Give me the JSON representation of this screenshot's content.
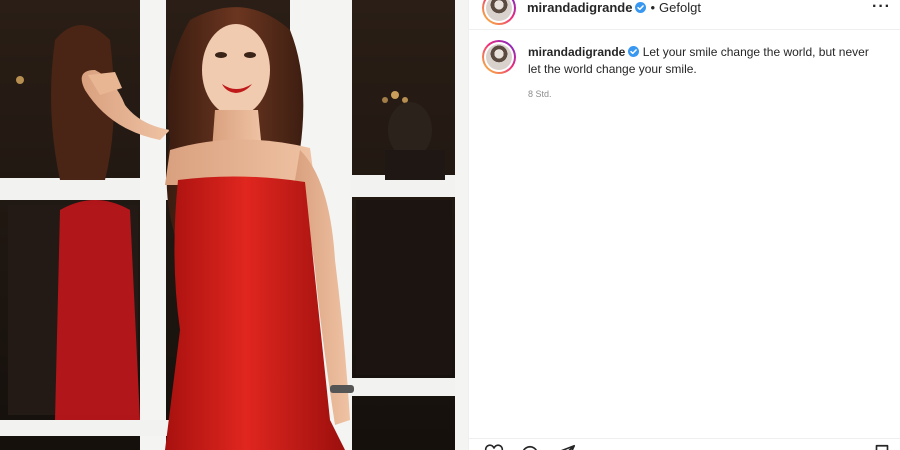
{
  "post": {
    "username": "mirandadigrande",
    "separator": "•",
    "follow_status": "Gefolgt",
    "more": "···"
  },
  "caption": {
    "username": "mirandadigrande",
    "text": "Let your smile change the world, but never let the world change your smile.",
    "timestamp": "8 Std."
  },
  "colors": {
    "verified": "#3897f0",
    "dress": "#d4211f",
    "text": "#262626",
    "muted": "#8e8e8e"
  },
  "icons": {
    "like": "heart-icon",
    "comment": "comment-icon",
    "share": "paper-plane-icon",
    "save": "bookmark-icon"
  }
}
